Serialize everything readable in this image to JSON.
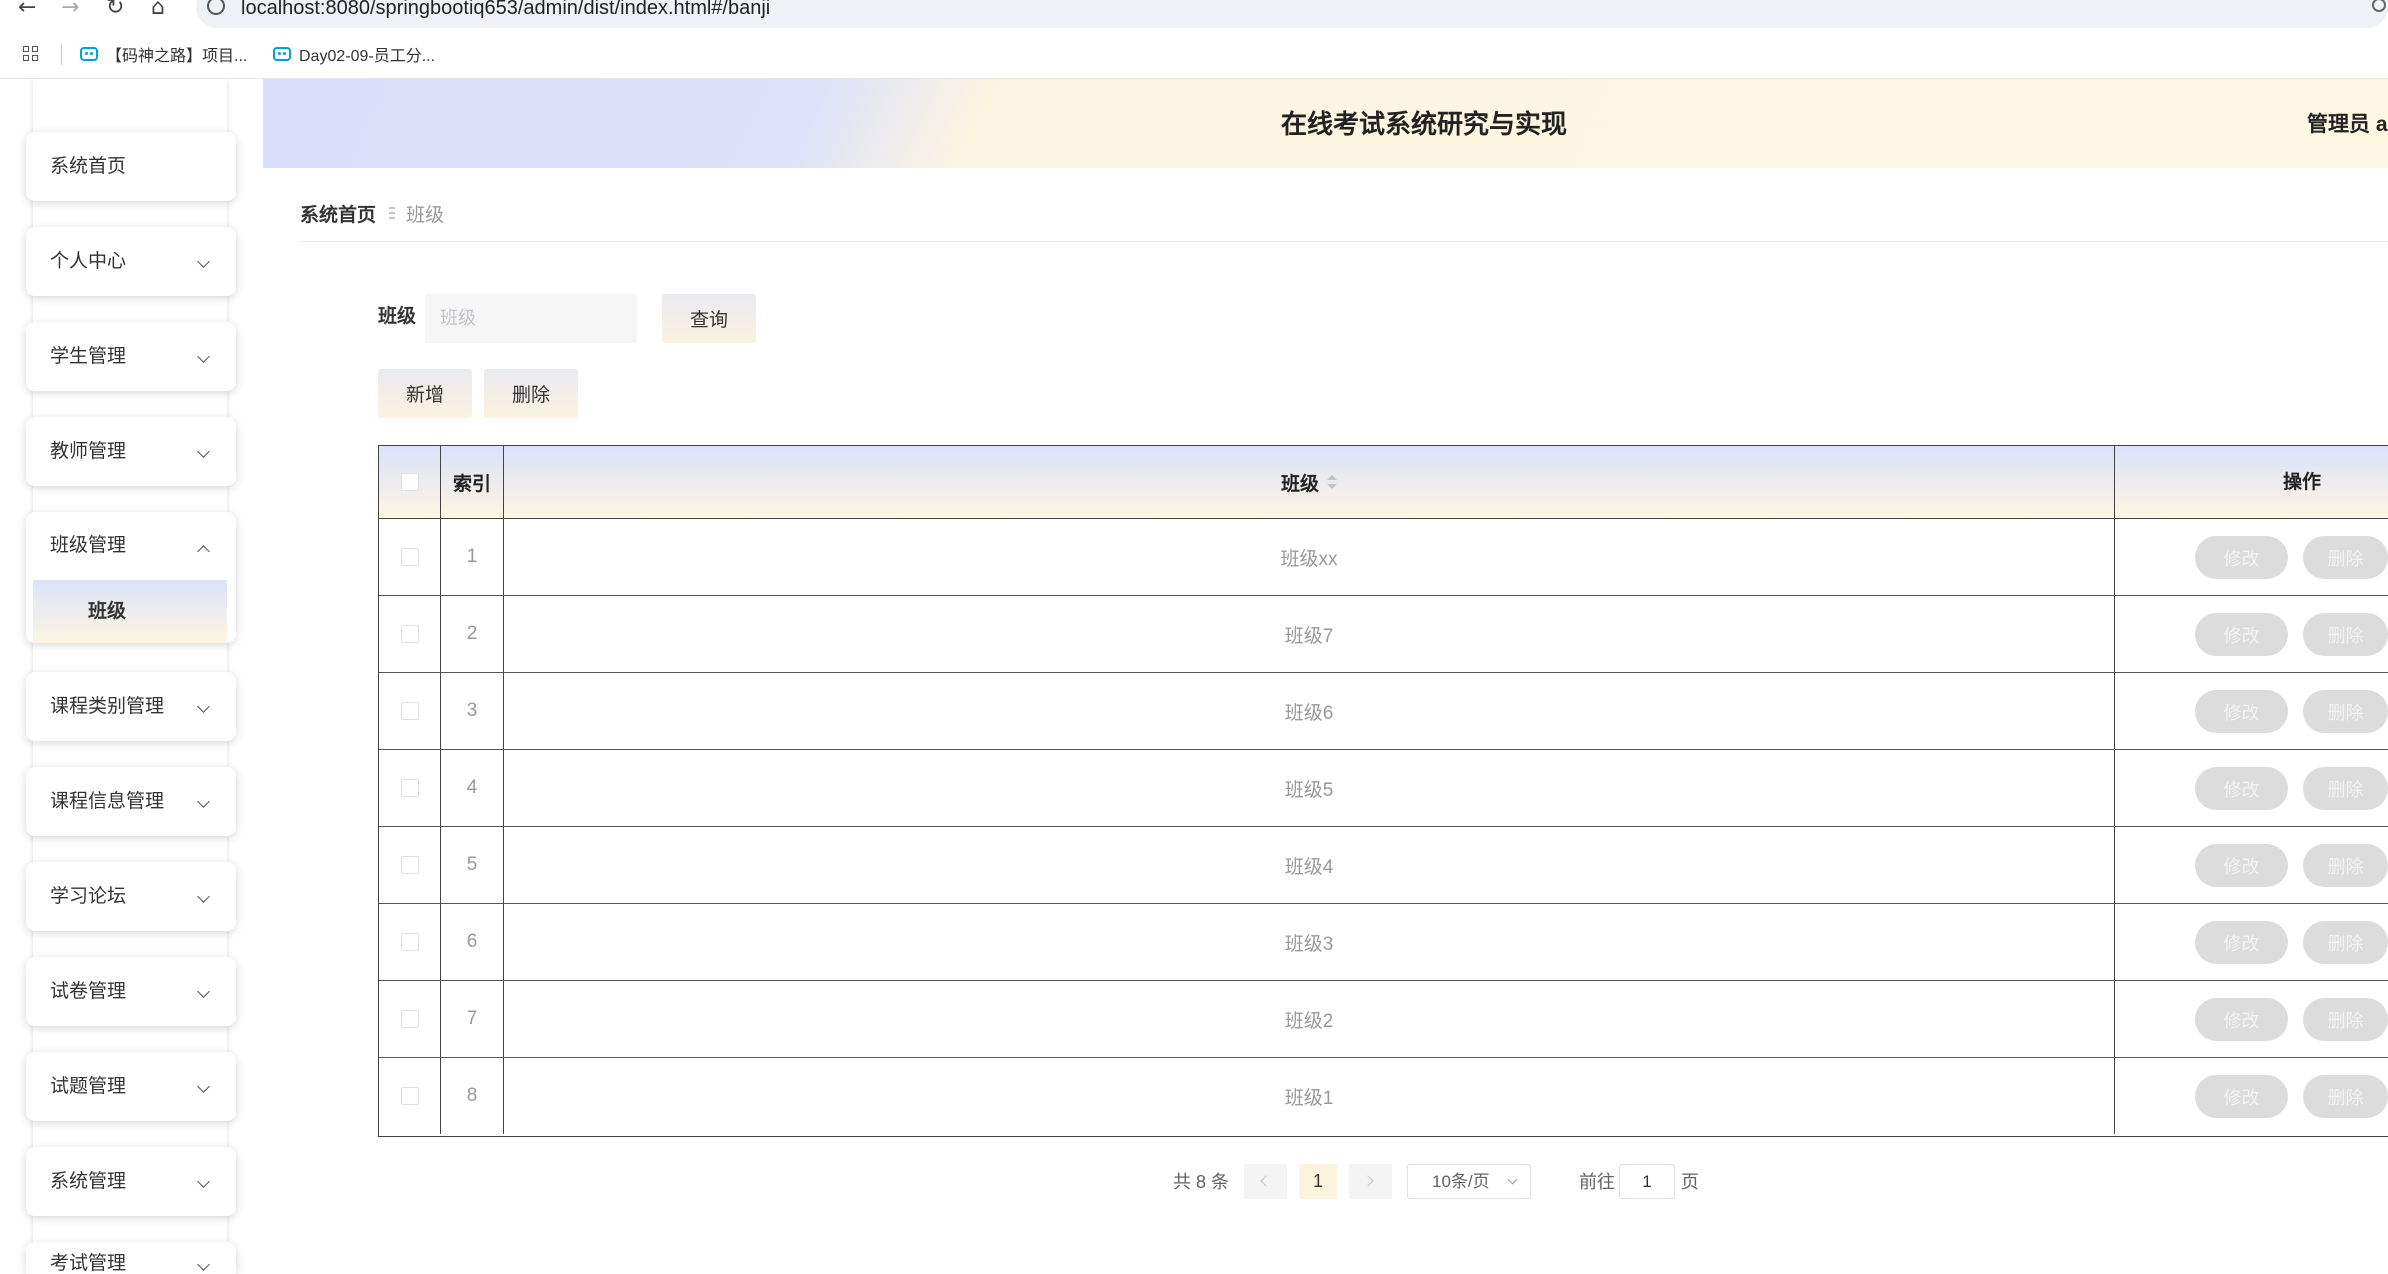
{
  "browser": {
    "url": "localhost:8080/springbootiq653/admin/dist/index.html#/banji",
    "bookmarks": [
      {
        "label": "【码神之路】项目..."
      },
      {
        "label": "Day02-09-员工分..."
      }
    ]
  },
  "header": {
    "title": "在线考试系统研究与实现",
    "user": "管理员 a"
  },
  "sidebar": {
    "items": [
      {
        "label": "系统首页"
      },
      {
        "label": "个人中心"
      },
      {
        "label": "学生管理"
      },
      {
        "label": "教师管理"
      },
      {
        "label": "班级管理",
        "expanded": true,
        "children": [
          {
            "label": "班级",
            "active": true
          }
        ]
      },
      {
        "label": "课程类别管理"
      },
      {
        "label": "课程信息管理"
      },
      {
        "label": "学习论坛"
      },
      {
        "label": "试卷管理"
      },
      {
        "label": "试题管理"
      },
      {
        "label": "系统管理"
      },
      {
        "label": "考试管理"
      }
    ]
  },
  "breadcrumb": {
    "home": "系统首页",
    "current": "班级"
  },
  "search": {
    "label": "班级",
    "placeholder": "班级",
    "button": "查询"
  },
  "toolbar": {
    "add": "新增",
    "delete": "删除"
  },
  "table": {
    "columns": {
      "index": "索引",
      "name": "班级",
      "actions": "操作"
    },
    "rows": [
      {
        "index": "1",
        "name": "班级xx"
      },
      {
        "index": "2",
        "name": "班级7"
      },
      {
        "index": "3",
        "name": "班级6"
      },
      {
        "index": "4",
        "name": "班级5"
      },
      {
        "index": "5",
        "name": "班级4"
      },
      {
        "index": "6",
        "name": "班级3"
      },
      {
        "index": "7",
        "name": "班级2"
      },
      {
        "index": "8",
        "name": "班级1"
      }
    ],
    "edit_label": "修改",
    "delete_label": "删除"
  },
  "pagination": {
    "total": "共 8 条",
    "current_page": "1",
    "page_size": "10条/页",
    "goto": "前往",
    "goto_value": "1",
    "page_suffix": "页"
  },
  "colors": {
    "header_gradient_start": "#d9defb",
    "header_gradient_end": "#fdf6e3",
    "table_border": "#444444",
    "muted_text": "#999999",
    "action_button_bg": "#dcdcdc",
    "bookmark_icon": "#00a1d6"
  }
}
